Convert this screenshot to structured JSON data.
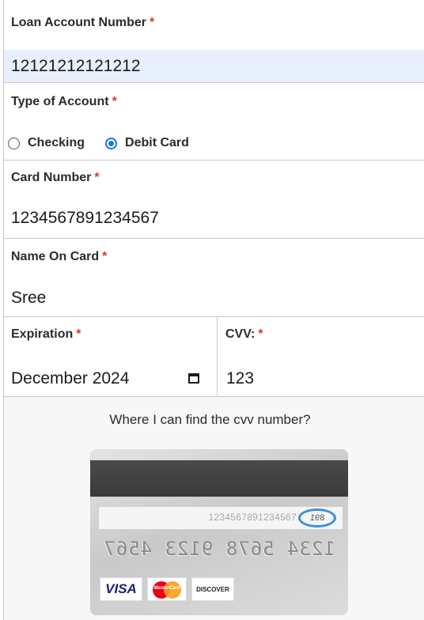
{
  "form": {
    "loan_account": {
      "label": "Loan Account Number",
      "required_mark": "*",
      "value": "12121212121212"
    },
    "account_type": {
      "label": "Type of Account",
      "required_mark": "*",
      "options": [
        {
          "label": "Checking",
          "selected": false
        },
        {
          "label": "Debit Card",
          "selected": true
        }
      ]
    },
    "card_number": {
      "label": "Card Number",
      "required_mark": "*",
      "value": "1234567891234567"
    },
    "name_on_card": {
      "label": "Name On Card",
      "required_mark": "*",
      "value": "Sree"
    },
    "expiration": {
      "label": "Expiration",
      "required_mark": "*",
      "value": "December 2024",
      "icon": "calendar-icon"
    },
    "cvv": {
      "label": "CVV:",
      "required_mark": "*",
      "value": "123"
    }
  },
  "cvv_help": {
    "title": "Where I can find the cvv number?",
    "card_image": {
      "signature_number": "1234567891234567",
      "cvv_digits": "891",
      "embossed_number": "1234 5678 9123 4567",
      "logos": [
        "VISA",
        "MasterCard",
        "DISCOVER"
      ]
    }
  },
  "colors": {
    "autofill_bg": "#e8f0fe",
    "required": "#d9362f",
    "radio_selected": "#1a73e8",
    "cvv_ring": "#3d8fd6"
  }
}
